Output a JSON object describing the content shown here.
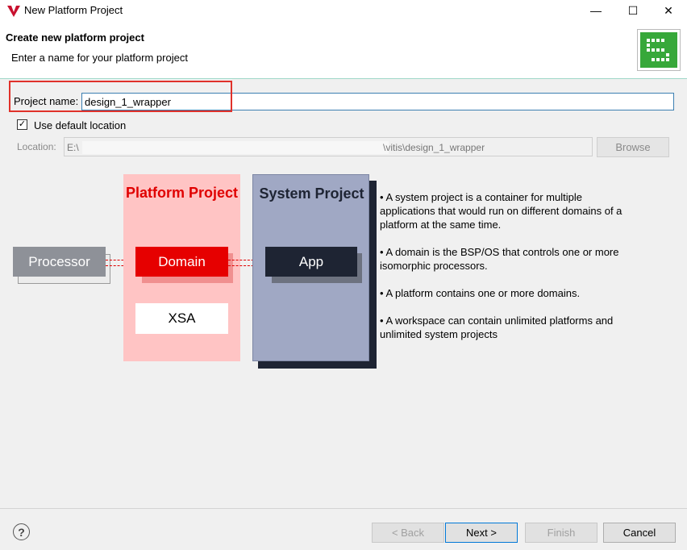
{
  "window": {
    "title": "New Platform Project",
    "minimize": "—",
    "maximize": "☐",
    "close": "✕"
  },
  "header": {
    "title": "Create new platform project",
    "description": "Enter a name for your platform project"
  },
  "form": {
    "project_name_label": "Project name:",
    "project_name_value": "design_1_wrapper",
    "use_default_location_label": "Use default location",
    "use_default_checked": true,
    "location_label": "Location:",
    "location_prefix": "E:\\",
    "location_suffix": "\\vitis\\design_1_wrapper",
    "browse_label": "Browse"
  },
  "diagram": {
    "processor": "Processor",
    "platform_title": "Platform Project",
    "domain": "Domain",
    "xsa": "XSA",
    "system_title": "System Project",
    "app": "App"
  },
  "notes": [
    "• A system project is a container for multiple applications that would run on different domains of a platform at the same time.",
    "• A domain is the BSP/OS that controls one or more isomorphic processors.",
    "• A platform contains one or more domains.",
    "• A workspace can contain unlimited platforms and unlimited system projects"
  ],
  "buttons": {
    "help": "?",
    "back": "< Back",
    "next": "Next >",
    "finish": "Finish",
    "cancel": "Cancel"
  },
  "colors": {
    "highlight": "#e0312a",
    "platform": "#ffc4c4",
    "domain": "#e60000",
    "system": "#a0a8c4",
    "app": "#1e2433"
  }
}
